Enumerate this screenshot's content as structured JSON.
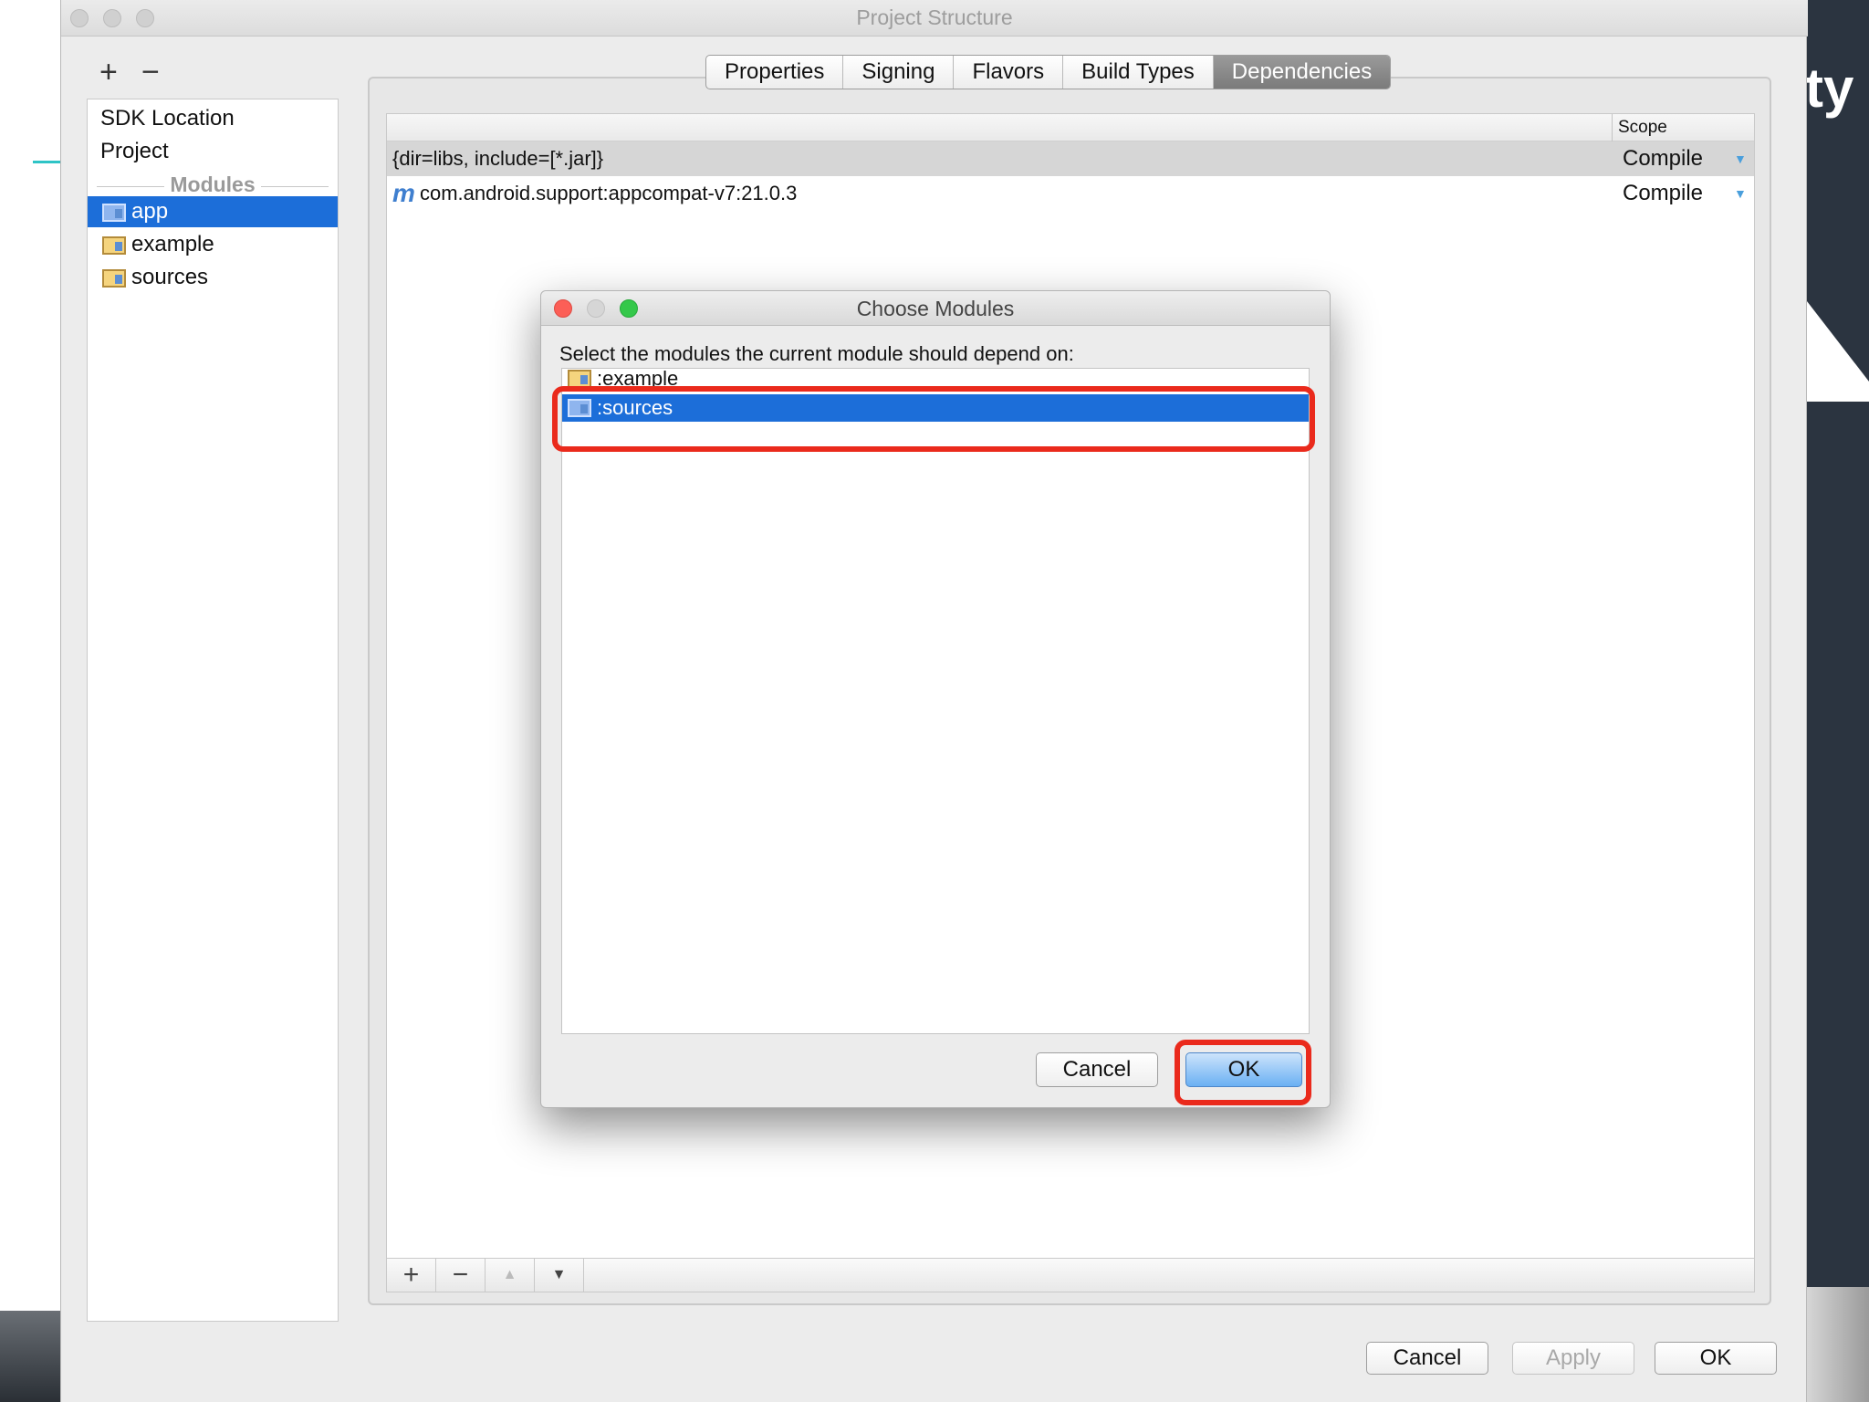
{
  "window": {
    "title": "Project Structure"
  },
  "sidebar": {
    "add_label": "+",
    "remove_label": "−",
    "items": [
      {
        "label": "SDK Location"
      },
      {
        "label": "Project"
      }
    ],
    "modules_header": "Modules",
    "modules": [
      {
        "label": "app",
        "selected": true
      },
      {
        "label": "example",
        "selected": false
      },
      {
        "label": "sources",
        "selected": false
      }
    ]
  },
  "tabs": [
    {
      "label": "Properties"
    },
    {
      "label": "Signing"
    },
    {
      "label": "Flavors"
    },
    {
      "label": "Build Types"
    },
    {
      "label": "Dependencies",
      "active": true
    }
  ],
  "dependencies": {
    "scope_header": "Scope",
    "rows": [
      {
        "name": "{dir=libs, include=[*.jar]}",
        "scope": "Compile"
      },
      {
        "prefix": "m",
        "name": "com.android.support:appcompat-v7:21.0.3",
        "scope": "Compile"
      }
    ],
    "toolbar": {
      "add": "+",
      "remove": "−",
      "up": "▲",
      "down": "▼"
    }
  },
  "buttons": {
    "cancel": "Cancel",
    "apply": "Apply",
    "ok": "OK"
  },
  "dialog": {
    "title": "Choose Modules",
    "prompt": "Select the modules the current module should depend on:",
    "modules": [
      {
        "label": ":example",
        "selected": false
      },
      {
        "label": ":sources",
        "selected": true
      }
    ],
    "cancel": "Cancel",
    "ok": "OK"
  },
  "background": {
    "slide_text": "ty"
  },
  "colors": {
    "selection": "#1c6ed9",
    "highlight": "#ea2a1c",
    "scope_arrow": "#4a9fdc"
  }
}
